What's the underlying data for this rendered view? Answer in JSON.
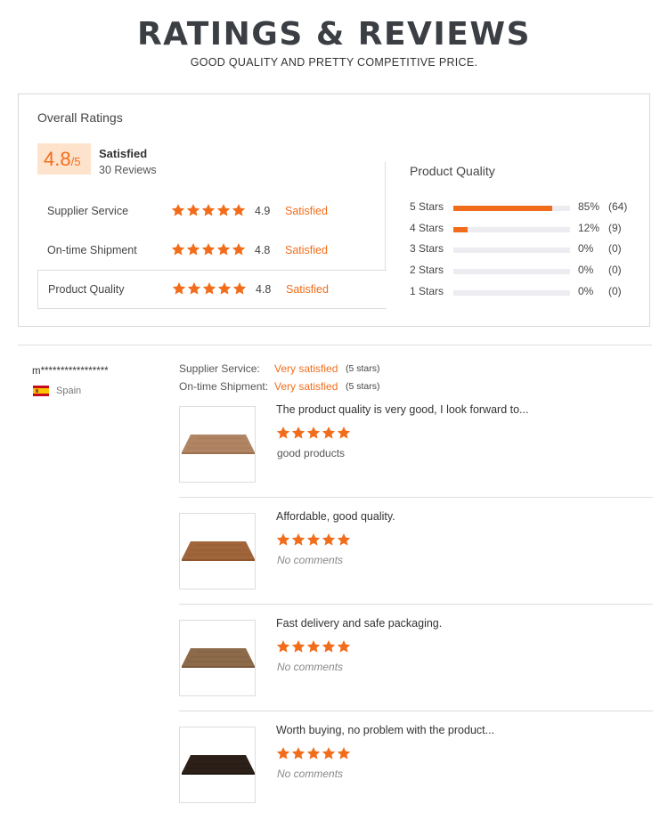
{
  "header": {
    "title": "RATINGS & REVIEWS",
    "subtitle": "GOOD QUALITY AND PRETTY COMPETITIVE PRICE."
  },
  "overall": {
    "heading": "Overall Ratings",
    "score": "4.8",
    "score_max": "/5",
    "label": "Satisfied",
    "reviews": "30 Reviews"
  },
  "criteria": [
    {
      "label": "Supplier Service",
      "rating": "4.9",
      "status": "Satisfied",
      "stars": 5
    },
    {
      "label": "On-time Shipment",
      "rating": "4.8",
      "status": "Satisfied",
      "stars": 5
    },
    {
      "label": "Product Quality",
      "rating": "4.8",
      "status": "Satisfied",
      "stars": 5
    }
  ],
  "product_quality": {
    "heading": "Product Quality",
    "rows": [
      {
        "label": "5 Stars",
        "fraction": 0.85,
        "percent": "85%",
        "count": "(64)"
      },
      {
        "label": "4 Stars",
        "fraction": 0.12,
        "percent": "12%",
        "count": "(9)"
      },
      {
        "label": "3 Stars",
        "fraction": 0,
        "percent": "0%",
        "count": "(0)"
      },
      {
        "label": "2 Stars",
        "fraction": 0,
        "percent": "0%",
        "count": "(0)"
      },
      {
        "label": "1 Stars",
        "fraction": 0,
        "percent": "0%",
        "count": "(0)"
      }
    ]
  },
  "review": {
    "reviewer": "m*****************",
    "country": "Spain",
    "supplier_service_label": "Supplier Service:",
    "supplier_service_value": "Very satisfied",
    "supplier_service_stars": "(5 stars)",
    "shipment_label": "On-time Shipment:",
    "shipment_value": "Very satisfied",
    "shipment_stars": "(5 stars)",
    "items": [
      {
        "title": "The product quality is very good, I look forward to...",
        "stars": 5,
        "comment": "good products",
        "has_comment": true
      },
      {
        "title": "Affordable, good quality.",
        "stars": 5,
        "comment": "No comments",
        "has_comment": false
      },
      {
        "title": "Fast delivery and safe packaging.",
        "stars": 5,
        "comment": "No comments",
        "has_comment": false
      },
      {
        "title": "Worth buying, no problem with the product...",
        "stars": 5,
        "comment": "No comments",
        "has_comment": false
      }
    ]
  },
  "colors": {
    "accent": "#f26d1b",
    "score_bg": "#fde2cc",
    "bar_track": "#ececf1"
  },
  "icons": {
    "star": "star-icon",
    "flag": "spain-flag-icon"
  }
}
